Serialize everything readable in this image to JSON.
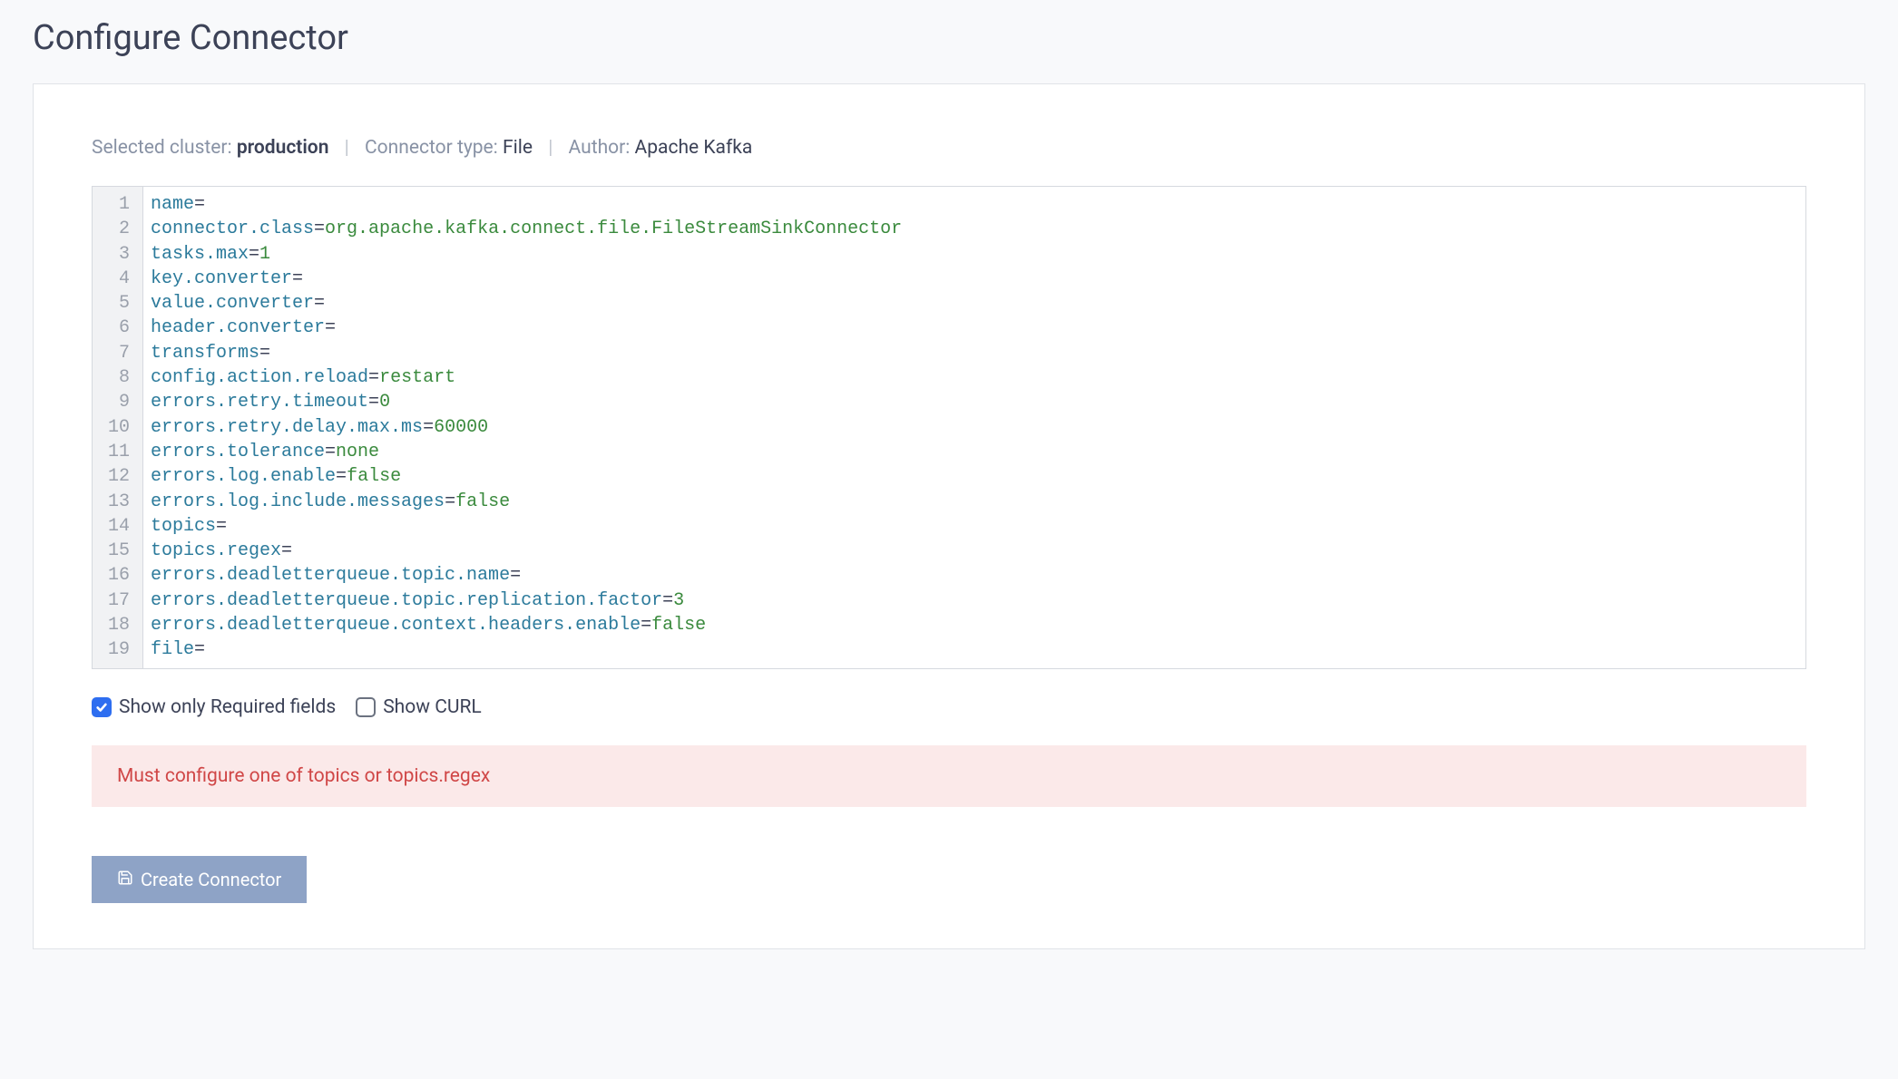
{
  "page_title": "Configure Connector",
  "meta": {
    "cluster_label": "Selected cluster:",
    "cluster_value": "production",
    "type_label": "Connector type:",
    "type_value": "File",
    "author_label": "Author:",
    "author_value": "Apache Kafka"
  },
  "config_lines": [
    {
      "key": "name",
      "value": ""
    },
    {
      "key": "connector.class",
      "value": "org.apache.kafka.connect.file.FileStreamSinkConnector"
    },
    {
      "key": "tasks.max",
      "value": "1"
    },
    {
      "key": "key.converter",
      "value": ""
    },
    {
      "key": "value.converter",
      "value": ""
    },
    {
      "key": "header.converter",
      "value": ""
    },
    {
      "key": "transforms",
      "value": ""
    },
    {
      "key": "config.action.reload",
      "value": "restart"
    },
    {
      "key": "errors.retry.timeout",
      "value": "0"
    },
    {
      "key": "errors.retry.delay.max.ms",
      "value": "60000"
    },
    {
      "key": "errors.tolerance",
      "value": "none"
    },
    {
      "key": "errors.log.enable",
      "value": "false"
    },
    {
      "key": "errors.log.include.messages",
      "value": "false"
    },
    {
      "key": "topics",
      "value": ""
    },
    {
      "key": "topics.regex",
      "value": ""
    },
    {
      "key": "errors.deadletterqueue.topic.name",
      "value": ""
    },
    {
      "key": "errors.deadletterqueue.topic.replication.factor",
      "value": "3"
    },
    {
      "key": "errors.deadletterqueue.context.headers.enable",
      "value": "false"
    },
    {
      "key": "file",
      "value": ""
    }
  ],
  "checkboxes": {
    "show_required": {
      "label": "Show only Required fields",
      "checked": true
    },
    "show_curl": {
      "label": "Show CURL",
      "checked": false
    }
  },
  "error_message": "Must configure one of topics or topics.regex",
  "create_button_label": "Create Connector"
}
